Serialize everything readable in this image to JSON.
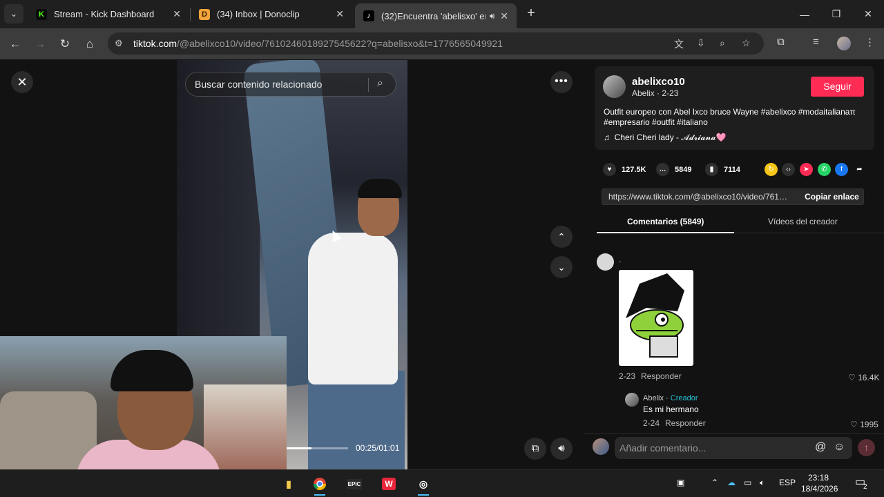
{
  "browser": {
    "tabs": [
      {
        "title": "Stream - Kick Dashboard",
        "favicon": "K",
        "favicon_color": "#53fc18"
      },
      {
        "title": "(34) Inbox | Donoclip",
        "favicon": "D",
        "favicon_color": "#f2a33a"
      },
      {
        "title": "(32)Encuentra 'abelisxo' en",
        "favicon": "♪",
        "favicon_color": "#ffffff"
      }
    ],
    "url_host": "tiktok.com",
    "url_path": "/@abelixco10/video/7610246018927545622?q=abelisxo&t=1776565049921"
  },
  "video": {
    "search_placeholder": "Buscar contenido relacionado",
    "time": "00:25/01:01",
    "progress": 0.41
  },
  "creator": {
    "username": "abelixco10",
    "subtitle": "Abelix · 2-23",
    "follow_label": "Seguir",
    "description": "Outfit europeo con Abel Ixco bruce Wayne #abelixco #modaitalianaπ #empresario #outfit #italiano",
    "music": "Cheri Cheri lady - 𝓐𝓭𝓻𝓲𝓪𝓷𝓪🩷"
  },
  "stats": {
    "likes": "127.5K",
    "comments": "5849",
    "saves": "7114"
  },
  "link": {
    "url": "https://www.tiktok.com/@abelixco10/video/76102...",
    "copy_label": "Copiar enlace"
  },
  "panel_tabs": {
    "comments": "Comentarios (5849)",
    "creator_videos": "Vídeos del creador"
  },
  "comments": [
    {
      "author": ".",
      "date": "2-23",
      "reply_label": "Responder",
      "likes": "16.4K"
    },
    {
      "author": "Abelix",
      "creator_tag": "Creador",
      "text": "Es mi hermano",
      "date": "2-24",
      "reply_label": "Responder",
      "likes": "1995"
    }
  ],
  "compose": {
    "placeholder": "Añadir comentario..."
  },
  "taskbar": {
    "lang": "ESP",
    "time": "23:18",
    "date": "18/4/2026",
    "notifications": "2"
  },
  "colors": {
    "accent": "#fe2c55",
    "creator_tag": "#25c2d8"
  }
}
